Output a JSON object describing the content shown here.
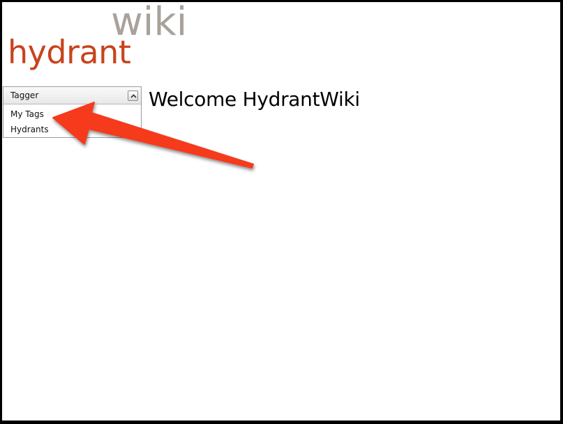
{
  "logo": {
    "part1": "hydrant",
    "part2": "wiki"
  },
  "sidebar": {
    "panel_title": "Tagger",
    "items": [
      {
        "label": "My Tags"
      },
      {
        "label": "Hydrants"
      }
    ]
  },
  "main": {
    "heading": "Welcome HydrantWiki"
  },
  "colors": {
    "logo_primary": "#c8431c",
    "logo_secondary": "#a8a29a",
    "annotation_arrow": "#f53a1e"
  },
  "icons": {
    "collapse": "chevron-up-icon",
    "annotation": "arrow-icon"
  }
}
